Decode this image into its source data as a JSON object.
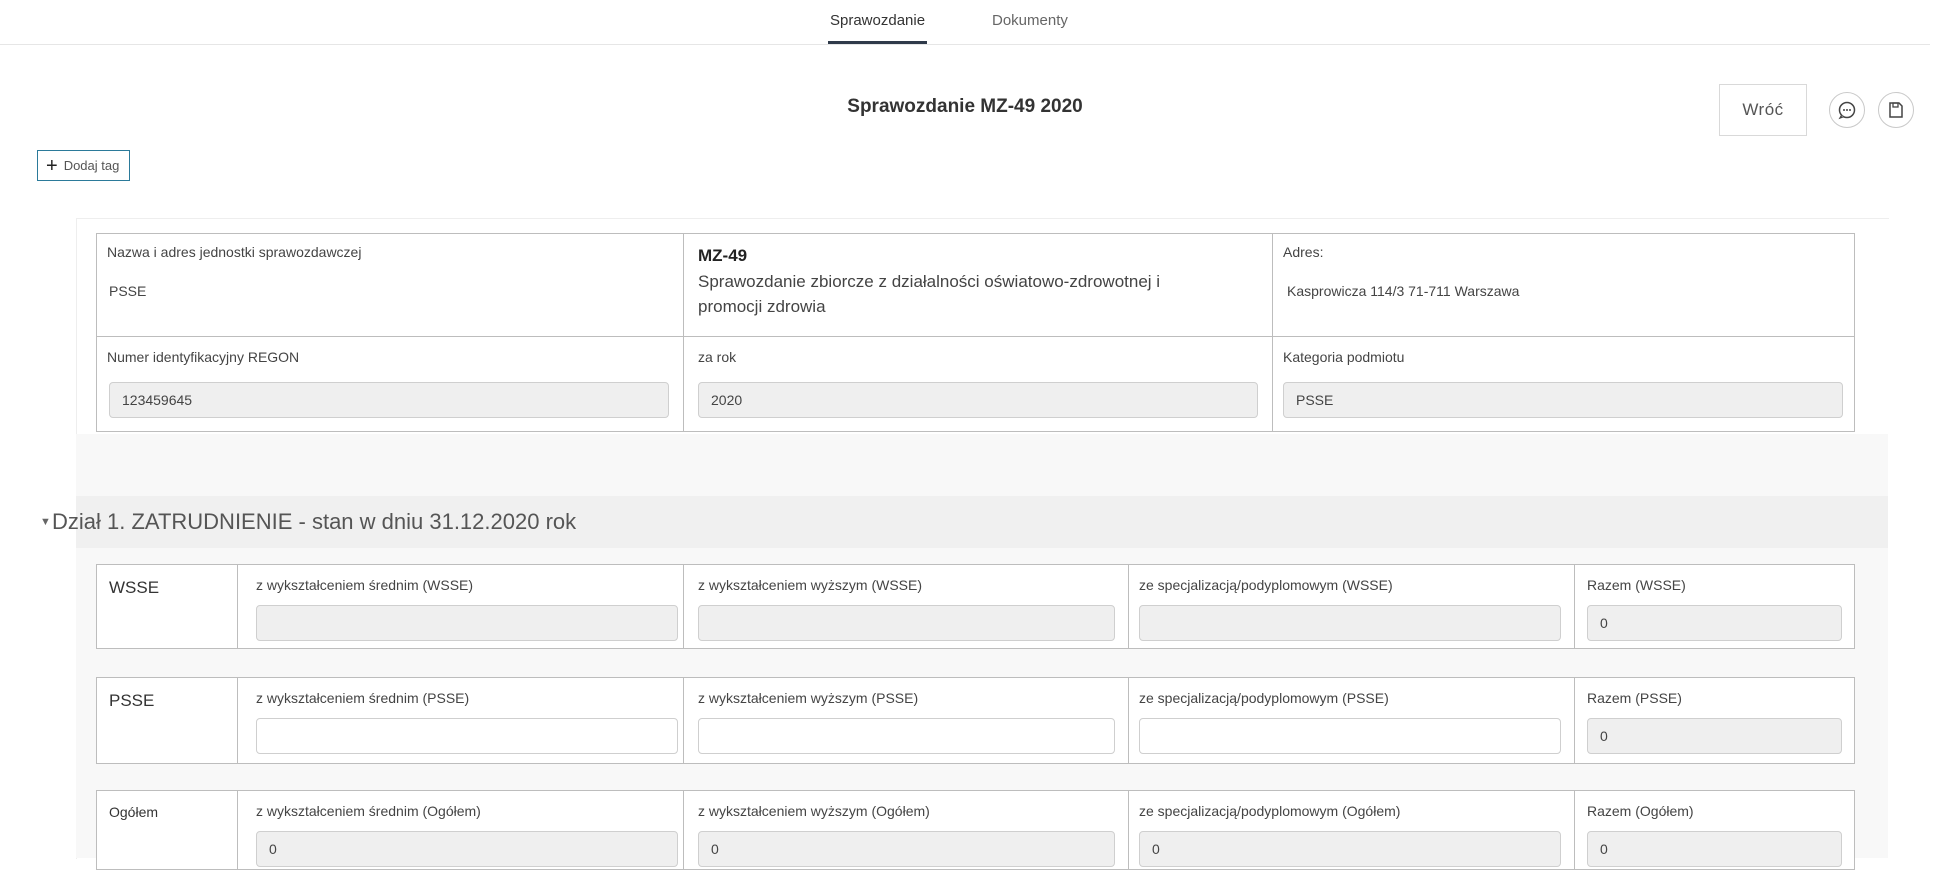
{
  "tabs": [
    {
      "label": "Sprawozdanie",
      "active": true
    },
    {
      "label": "Dokumenty",
      "active": false
    }
  ],
  "page_title": "Sprawozdanie MZ-49 2020",
  "actions": {
    "back_label": "Wróć",
    "add_tag_label": "Dodaj tag"
  },
  "icons": {
    "chat": "chat-bubble-icon",
    "save": "save-icon",
    "add": "plus-icon",
    "collapse": "caret-down-icon"
  },
  "header_form": {
    "unit_label": "Nazwa i adres jednostki sprawozdawczej",
    "unit_value": "PSSE",
    "form_code": "MZ-49",
    "form_desc": "Sprawozdanie zbiorcze z działalności oświatowo-zdrowotnej i promocji zdrowia",
    "address_label": "Adres:",
    "address_value": "Kasprowicza 114/3 71-711 Warszawa",
    "regon_label": "Numer identyfikacyjny REGON",
    "regon_value": "123459645",
    "year_label": "za rok",
    "year_value": "2020",
    "category_label": "Kategoria podmiotu",
    "category_value": "PSSE"
  },
  "section1": {
    "title": "Dział 1. ZATRUDNIENIE - stan w dniu 31.12.2020 rok",
    "rows": [
      {
        "label": "WSSE",
        "fields": [
          {
            "label": "z wykształceniem średnim (WSSE)",
            "value": ""
          },
          {
            "label": "z wykształceniem wyższym (WSSE)",
            "value": ""
          },
          {
            "label": "ze specjalizacją/podyplomowym (WSSE)",
            "value": ""
          },
          {
            "label": "Razem (WSSE)",
            "value": "0"
          }
        ]
      },
      {
        "label": "PSSE",
        "fields": [
          {
            "label": "z wykształceniem średnim (PSSE)",
            "value": ""
          },
          {
            "label": "z wykształceniem wyższym (PSSE)",
            "value": ""
          },
          {
            "label": "ze specjalizacją/podyplomowym (PSSE)",
            "value": ""
          },
          {
            "label": "Razem (PSSE)",
            "value": "0"
          }
        ]
      },
      {
        "label": "Ogółem",
        "fields": [
          {
            "label": "z wykształceniem średnim (Ogółem)",
            "value": "0"
          },
          {
            "label": "z wykształceniem wyższym (Ogółem)",
            "value": "0"
          },
          {
            "label": "ze specjalizacją/podyplomowym (Ogółem)",
            "value": "0"
          },
          {
            "label": "Razem (Ogółem)",
            "value": "0"
          }
        ]
      }
    ]
  }
}
